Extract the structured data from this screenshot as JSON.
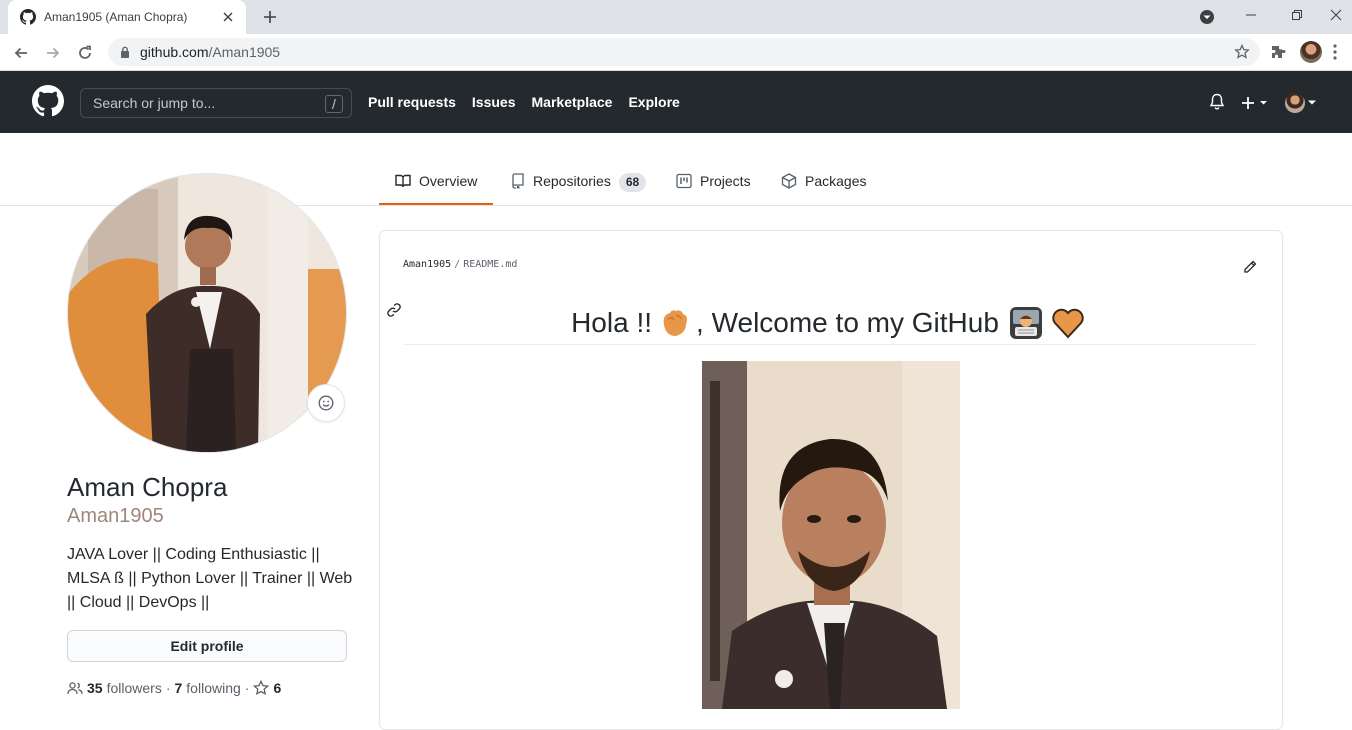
{
  "browser": {
    "tab_title": "Aman1905 (Aman Chopra)",
    "url_host": "github.com",
    "url_path": "/Aman1905"
  },
  "header": {
    "search_placeholder": "Search or jump to...",
    "search_shortcut": "/",
    "nav": [
      "Pull requests",
      "Issues",
      "Marketplace",
      "Explore"
    ]
  },
  "tabs": [
    {
      "label": "Overview",
      "active": true
    },
    {
      "label": "Repositories",
      "count": "68"
    },
    {
      "label": "Projects"
    },
    {
      "label": "Packages"
    }
  ],
  "profile": {
    "name": "Aman Chopra",
    "login": "Aman1905",
    "bio": "JAVA Lover || Coding Enthusiastic || MLSA ß || Python Lover || Trainer || Web || Cloud || DevOps ||",
    "edit_button": "Edit profile",
    "followers_count": "35",
    "followers_label": "followers",
    "separator": "·",
    "following_count": "7",
    "following_label": "following",
    "stars_count": "6"
  },
  "readme": {
    "owner": "Aman1905",
    "path_separator": "/",
    "file": "README.md",
    "heading_part1": "Hola !!",
    "heading_part2": ", Welcome to my GitHub"
  },
  "colors": {
    "header_bg": "#24292e",
    "active_tab_border": "#e36209",
    "accent_orange": "#e8964a"
  },
  "icons": [
    "github-favicon-icon",
    "close-icon",
    "plus-icon",
    "back-icon",
    "forward-icon",
    "reload-icon",
    "lock-icon",
    "star-bookmark-icon",
    "extensions-icon",
    "menu-icon",
    "github-logo-icon",
    "bell-icon",
    "book-icon",
    "repo-icon",
    "project-icon",
    "package-icon",
    "smiley-icon",
    "people-icon",
    "star-icon",
    "pencil-icon",
    "link-icon",
    "wave-emoji-icon",
    "technologist-emoji-icon",
    "orange-heart-icon"
  ]
}
